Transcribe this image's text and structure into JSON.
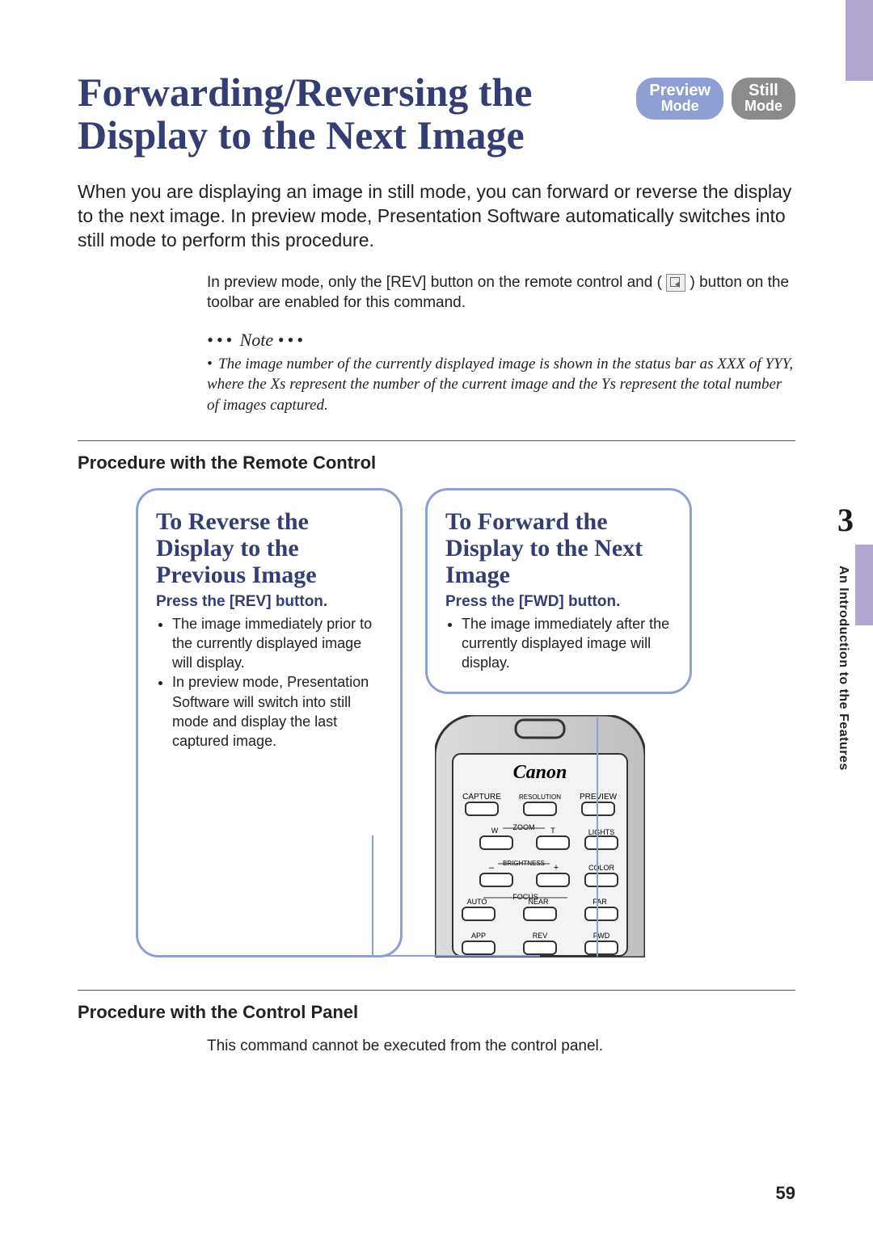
{
  "title": "Forwarding/Reversing the Display to the Next Image",
  "badges": {
    "preview": {
      "line1": "Preview",
      "line2": "Mode"
    },
    "still": {
      "line1": "Still",
      "line2": "Mode"
    }
  },
  "intro": "When you are displaying an image in still mode, you can forward or reverse the display to the next image. In preview mode, Presentation Software automatically switches into still mode to perform this procedure.",
  "subnote_a": "In preview mode, only the [REV] button on the remote control and (",
  "subnote_b": ") button on the toolbar are enabled for this command.",
  "note_label": "Note",
  "note_body": "The image number of the currently displayed image is shown in the status bar as XXX of YYY, where the Xs represent the number of the current image and the Ys represent the total number of images captured.",
  "section_remote": "Procedure with the Remote Control",
  "card_reverse": {
    "title": "To Reverse the Display to the Previous Image",
    "action": "Press the [REV] button.",
    "b1": "The image immediately prior to the currently displayed image will display.",
    "b2": "In preview mode, Presentation Software will switch into still mode and display the last captured image."
  },
  "card_forward": {
    "title": "To Forward the Display to the Next Image",
    "action": "Press the [FWD] button.",
    "b1": "The image immediately after the currently displayed image will display."
  },
  "remote": {
    "brand": "Canon",
    "labels": {
      "capture": "CAPTURE",
      "resolution": "RESOLUTION",
      "preview": "PREVIEW",
      "zoom": "ZOOM",
      "w": "W",
      "t": "T",
      "lights": "LIGHTS",
      "brightness": "BRIGHTNESS",
      "minus": "–",
      "plus": "+",
      "color": "COLOR",
      "focus": "FOCUS",
      "auto": "AUTO",
      "near": "NEAR",
      "far": "FAR",
      "app": "APP",
      "rev": "REV",
      "fwd": "FWD"
    }
  },
  "section_panel": "Procedure with the Control Panel",
  "panel_note": "This command cannot be executed from the control panel.",
  "chapter_number": "3",
  "chapter_label": "An Introduction to the Features",
  "page_number": "59"
}
